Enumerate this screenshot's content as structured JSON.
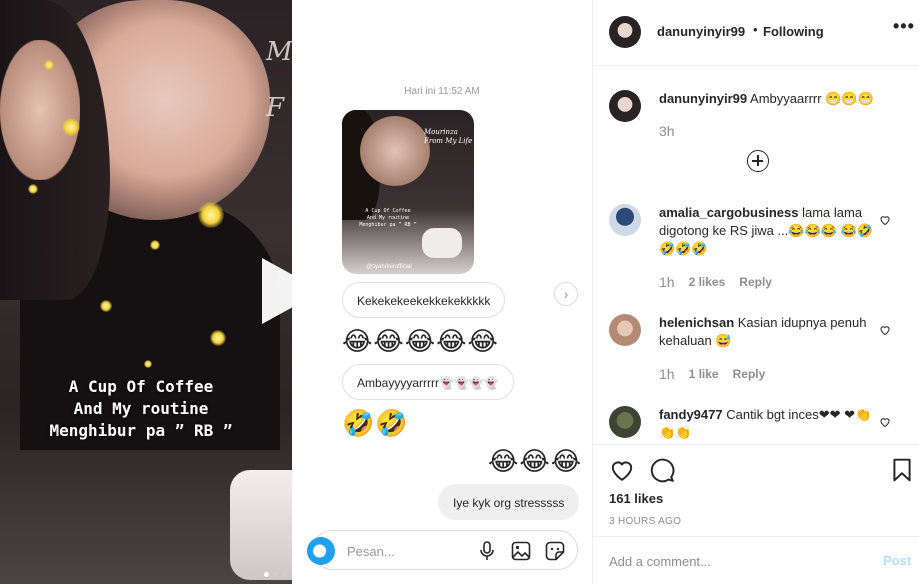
{
  "video": {
    "overlay_lines": [
      "A Cup Of Coffee",
      "And My routine",
      "Menghibur pa ” RB ”"
    ],
    "side_text": "M\nF",
    "carousel_dots": 3,
    "active_dot": 0
  },
  "dm": {
    "timestamp": "Hari ini 11:52 AM",
    "shared_post": {
      "title_text": "Mourinza\nFrom My Life",
      "caption_lines": [
        "A Cup Of Coffee",
        "And My routine",
        "Menghibur pa ” RB ”"
      ],
      "tag": "@syahrinirofficial"
    },
    "messages": [
      {
        "kind": "bubble",
        "text": "Kekekekeekekkekekkkkk",
        "mine": false
      },
      {
        "kind": "emoji",
        "text": "😂😂😂😂😂",
        "mine": false
      },
      {
        "kind": "bubble",
        "text": "Ambayyyyarrrrr👻👻👻👻",
        "mine": false
      },
      {
        "kind": "emoji",
        "text": "🤣🤣",
        "mine": false
      },
      {
        "kind": "emoji",
        "text": "😂😂😂",
        "mine": true
      },
      {
        "kind": "bubble",
        "text": "Iye kyk org stresssss",
        "mine": true
      }
    ],
    "composer_placeholder": "Pesan...",
    "composer_icons": [
      "microphone-icon",
      "image-icon",
      "sticker-icon"
    ]
  },
  "post": {
    "owner": "danunyinyir99",
    "separator": "•",
    "follow_status": "Following",
    "more_label": "•••",
    "caption": {
      "user": "danunyinyir99",
      "text": "Ambyyaarrrr 😁😁😁",
      "time": "3h"
    },
    "comments": [
      {
        "user": "amalia_cargobusiness",
        "text": "lama lama digotong ke RS jiwa ...😂😂😂 😂🤣🤣🤣🤣",
        "time": "1h",
        "likes": "2 likes",
        "reply": "Reply"
      },
      {
        "user": "helenichsan",
        "text": "Kasian idupnya penuh kehaluan 😅",
        "time": "1h",
        "likes": "1 like",
        "reply": "Reply"
      },
      {
        "user": "fandy9477",
        "text": "Cantik bgt inces❤❤ ❤👏👏👏",
        "time": "",
        "likes": "",
        "reply": ""
      }
    ],
    "likes": "161 likes",
    "posted_ago": "3 HOURS AGO",
    "add_comment_placeholder": "Add a comment...",
    "post_button": "Post",
    "colors": {
      "link_disabled": "#b2dffc",
      "muted": "#8e8e8e",
      "heart_red": "#ed4956"
    }
  }
}
